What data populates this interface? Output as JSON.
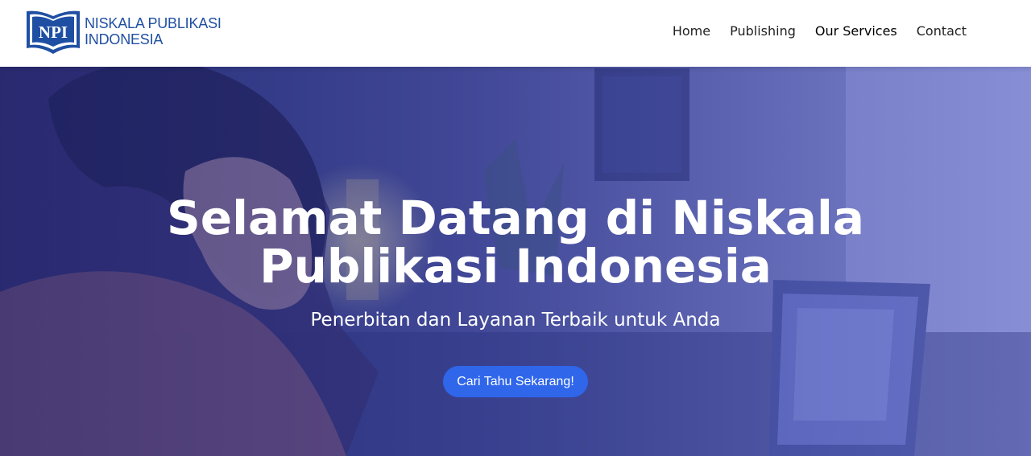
{
  "brand": {
    "logo_mark_text": "NPI",
    "name_line1": "NISKALA PUBLIKASI",
    "name_line2": "INDONESIA"
  },
  "nav": {
    "items": [
      {
        "label": "Home"
      },
      {
        "label": "Publishing"
      },
      {
        "label": "Our Services",
        "active": true
      },
      {
        "label": "Contact"
      }
    ]
  },
  "hero": {
    "title": "Selamat Datang di Niskala Publikasi Indonesia",
    "subtitle": "Penerbitan dan Layanan Terbaik untuk Anda",
    "cta_label": "Cari Tahu Sekarang!"
  },
  "colors": {
    "brand_blue": "#1f4fa3",
    "cta_blue": "#2f66ea",
    "hero_overlay": "#3f4aa8"
  }
}
